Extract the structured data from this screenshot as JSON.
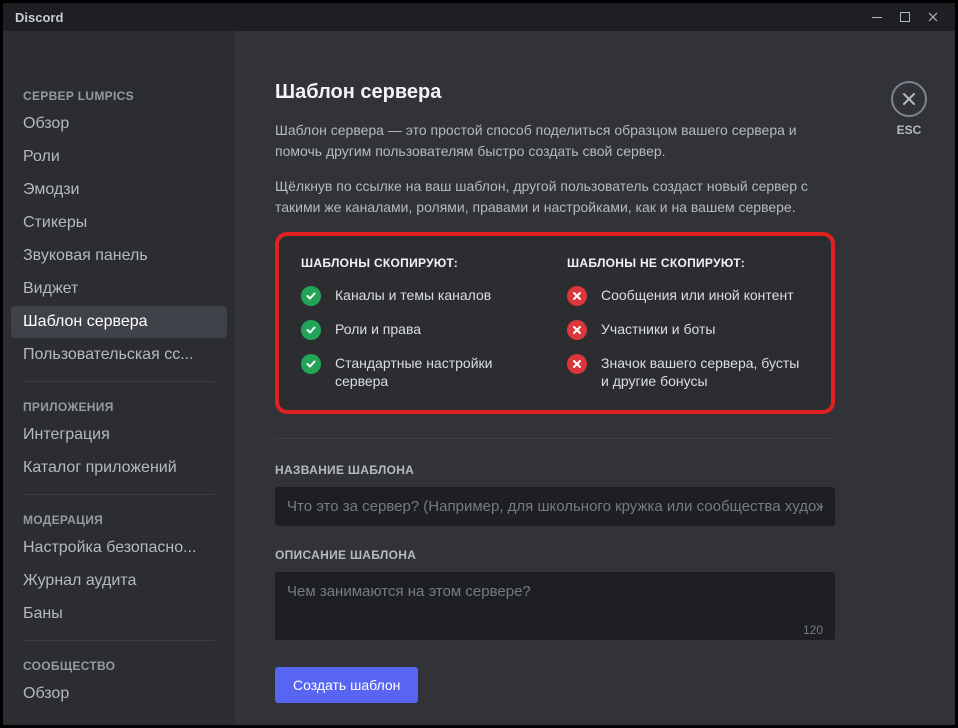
{
  "titlebar": {
    "title": "Discord"
  },
  "sidebar": {
    "section1_header": "СЕРВЕР LUMPICS",
    "section1": [
      "Обзор",
      "Роли",
      "Эмодзи",
      "Стикеры",
      "Звуковая панель",
      "Виджет",
      "Шаблон сервера",
      "Пользовательская сс..."
    ],
    "section2_header": "ПРИЛОЖЕНИЯ",
    "section2": [
      "Интеграция",
      "Каталог приложений"
    ],
    "section3_header": "МОДЕРАЦИЯ",
    "section3": [
      "Настройка безопасно...",
      "Журнал аудита",
      "Баны"
    ],
    "section4_header": "СООБЩЕСТВО",
    "section4": [
      "Обзор"
    ]
  },
  "main": {
    "title": "Шаблон сервера",
    "desc1": "Шаблон сервера — это простой способ поделиться образцом вашего сервера и помочь другим пользователям быстро создать свой сервер.",
    "desc2": "Щёлкнув по ссылке на ваш шаблон, другой пользователь создаст новый сервер с такими же каналами, ролями, правами и настройками, как и на вашем сервере.",
    "copy_header": "ШАБЛОНЫ СКОПИРУЮТ:",
    "nocopy_header": "ШАБЛОНЫ НЕ СКОПИРУЮТ:",
    "copy_items": [
      "Каналы и темы каналов",
      "Роли и права",
      "Стандартные настройки сервера"
    ],
    "nocopy_items": [
      "Сообщения или иной контент",
      "Участники и боты",
      "Значок вашего сервера, бусты и другие бонусы"
    ],
    "name_label": "НАЗВАНИЕ ШАБЛОНА",
    "name_placeholder": "Что это за сервер? (Например, для школьного кружка или сообщества худож",
    "desc_label": "ОПИСАНИЕ ШАБЛОНА",
    "desc_placeholder": "Чем занимаются на этом сервере?",
    "char_count": "120",
    "create_button": "Создать шаблон",
    "esc_label": "ESC"
  }
}
